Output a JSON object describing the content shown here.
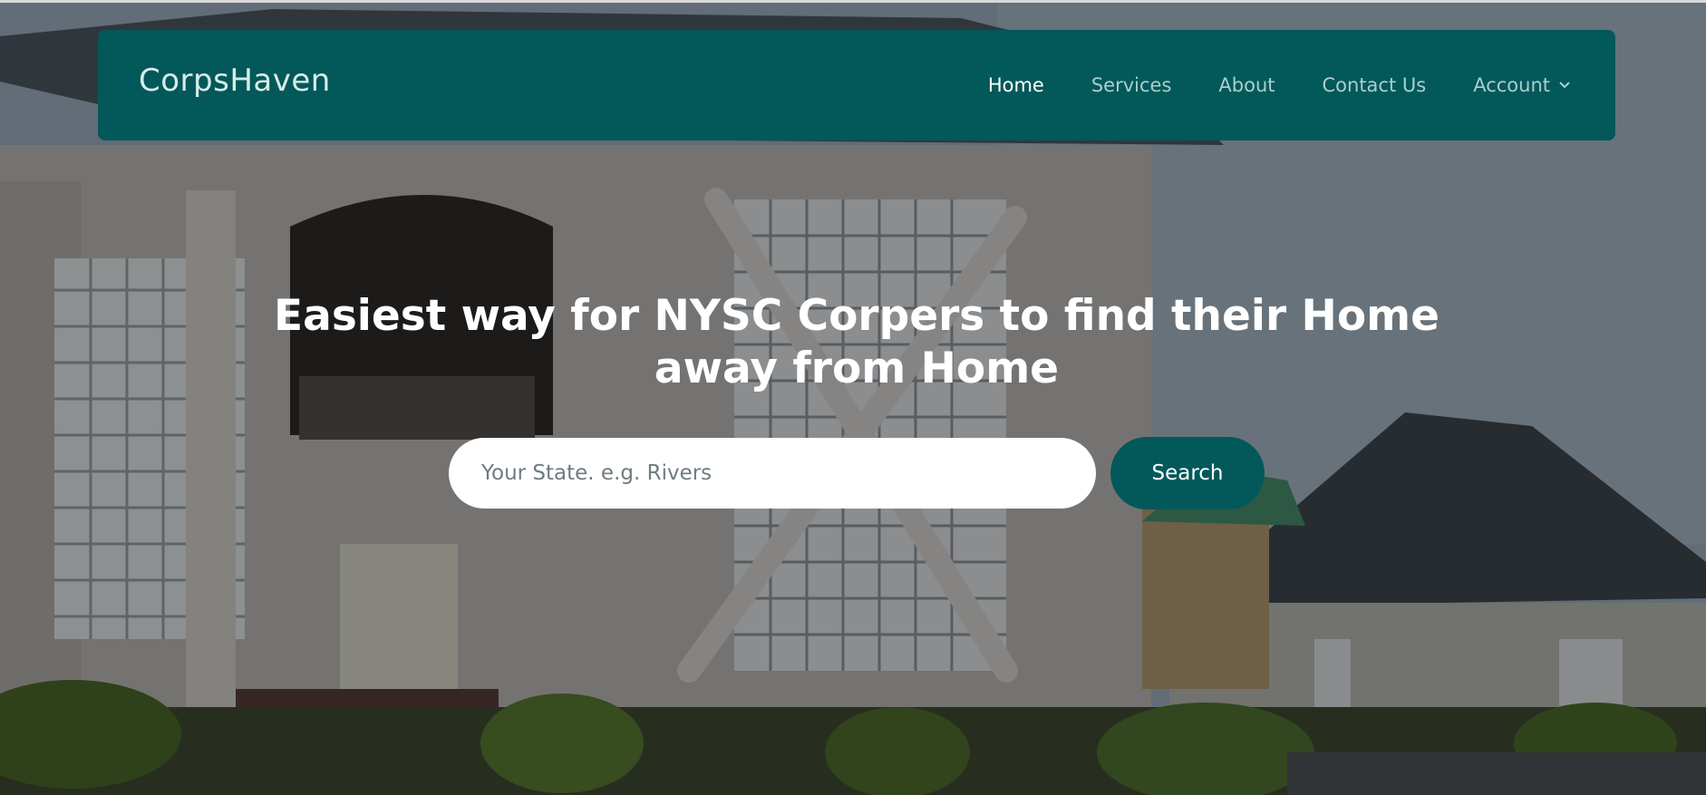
{
  "brand": {
    "name": "CorpsHaven"
  },
  "nav": {
    "items": [
      {
        "label": "Home",
        "active": true
      },
      {
        "label": "Services",
        "active": false
      },
      {
        "label": "About",
        "active": false
      },
      {
        "label": "Contact Us",
        "active": false
      },
      {
        "label": "Account",
        "active": false,
        "dropdown": true
      }
    ],
    "dropdown_icon": "chevron-down-icon"
  },
  "hero": {
    "headline_line1": "Easiest way for NYSC Corpers to find their Home",
    "headline_line2": "away from Home",
    "background": "photo of a large grey mansion and a smaller house with dark roofs",
    "search": {
      "placeholder": "Your State. e.g. Rivers",
      "value": "",
      "button_label": "Search"
    }
  },
  "colors": {
    "brand_teal": "#03585a",
    "nav_text": "#a9cfcc",
    "nav_active": "#ffffff",
    "headline": "#ffffff"
  }
}
